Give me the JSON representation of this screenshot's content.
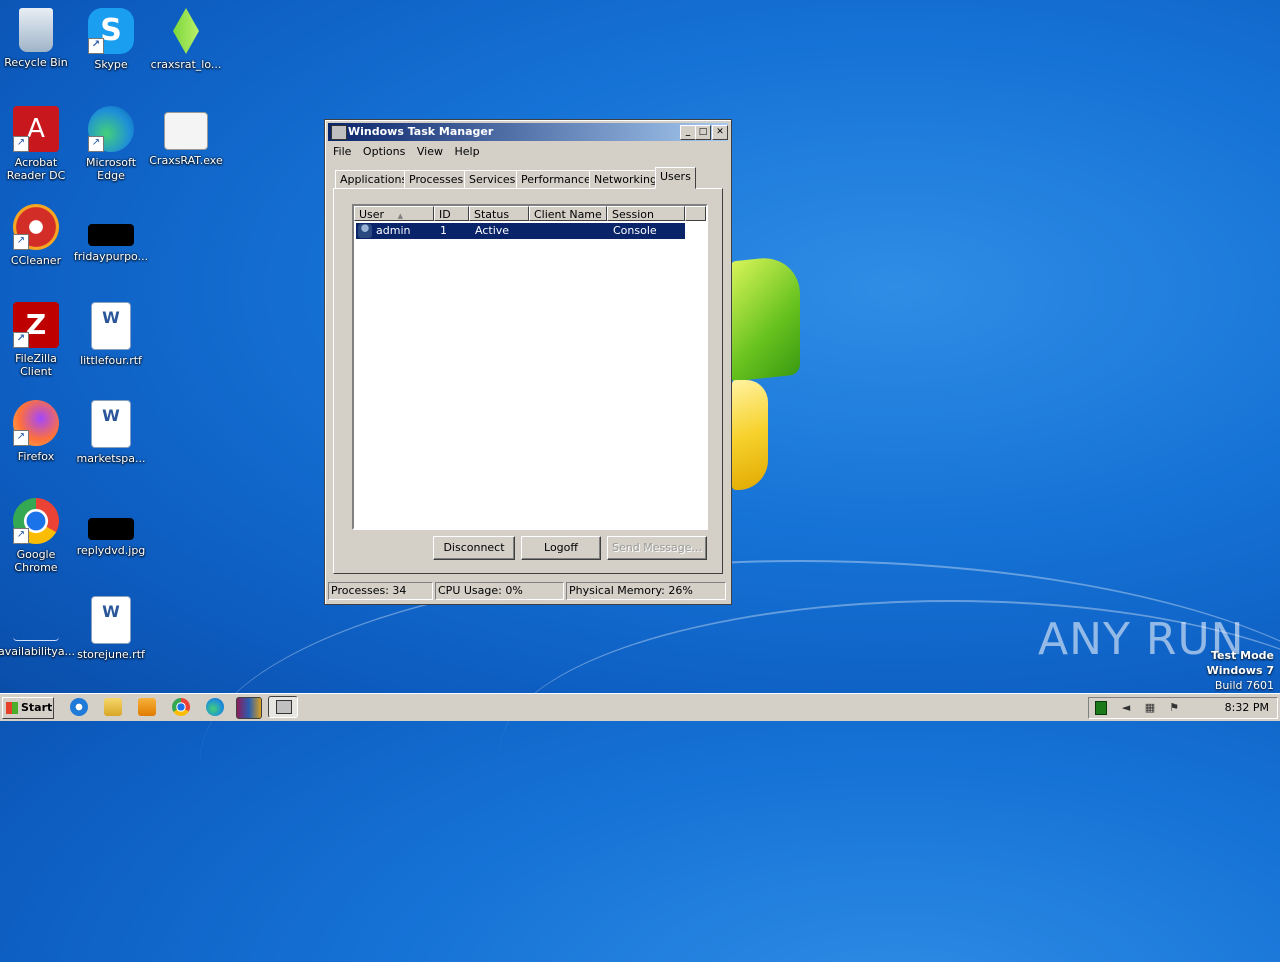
{
  "desktop": {
    "icons": [
      {
        "label": "Recycle Bin",
        "icon": "recycle-bin-icon"
      },
      {
        "label": "Skype",
        "icon": "skype-icon"
      },
      {
        "label": "craxsrat_lo...",
        "icon": "green-gem-icon"
      },
      {
        "label": "Acrobat Reader DC",
        "icon": "acrobat-icon"
      },
      {
        "label": "Microsoft Edge",
        "icon": "edge-icon"
      },
      {
        "label": "CraxsRAT.exe",
        "icon": "exe-window-icon"
      },
      {
        "label": "CCleaner",
        "icon": "ccleaner-icon"
      },
      {
        "label": "fridaypurpo...",
        "icon": "black-image-icon"
      },
      {
        "label": "FileZilla Client",
        "icon": "filezilla-icon"
      },
      {
        "label": "littlefour.rtf",
        "icon": "word-doc-icon"
      },
      {
        "label": "Firefox",
        "icon": "firefox-icon"
      },
      {
        "label": "marketspa...",
        "icon": "word-doc-icon"
      },
      {
        "label": "Google Chrome",
        "icon": "chrome-icon"
      },
      {
        "label": "replydvd.jpg",
        "icon": "black-image-icon"
      },
      {
        "label": "availabilitya...",
        "icon": "blank-file-icon"
      },
      {
        "label": "storejune.rtf",
        "icon": "word-doc-icon"
      }
    ]
  },
  "window": {
    "title": "Windows Task Manager",
    "minimize": "_",
    "maximize": "□",
    "close": "✕",
    "menu": [
      "File",
      "Options",
      "View",
      "Help"
    ],
    "tabs": [
      "Applications",
      "Processes",
      "Services",
      "Performance",
      "Networking",
      "Users"
    ],
    "active_tab": "Users",
    "columns": [
      "User",
      "ID",
      "Status",
      "Client Name",
      "Session"
    ],
    "sort_indicator": "▲",
    "rows": [
      {
        "user": "admin",
        "id": "1",
        "status": "Active",
        "client_name": "",
        "session": "Console",
        "selected": true
      }
    ],
    "buttons": {
      "disconnect": "Disconnect",
      "logoff": "Logoff",
      "send_message": "Send Message..."
    },
    "status": {
      "processes": "Processes: 34",
      "cpu": "CPU Usage: 0%",
      "memory": "Physical Memory: 26%"
    },
    "selection_color": "#0a246a"
  },
  "taskbar": {
    "start": "Start",
    "quick_launch": [
      "ie-icon",
      "explorer-icon",
      "media-player-icon",
      "chrome-icon",
      "edge-icon",
      "winrar-icon",
      "task-manager-icon"
    ],
    "clock": "8:32 PM"
  },
  "watermark": "ANY RUN",
  "test_mode": {
    "line1": "Test Mode",
    "line2": "Windows 7",
    "line3": "Build 7601"
  }
}
